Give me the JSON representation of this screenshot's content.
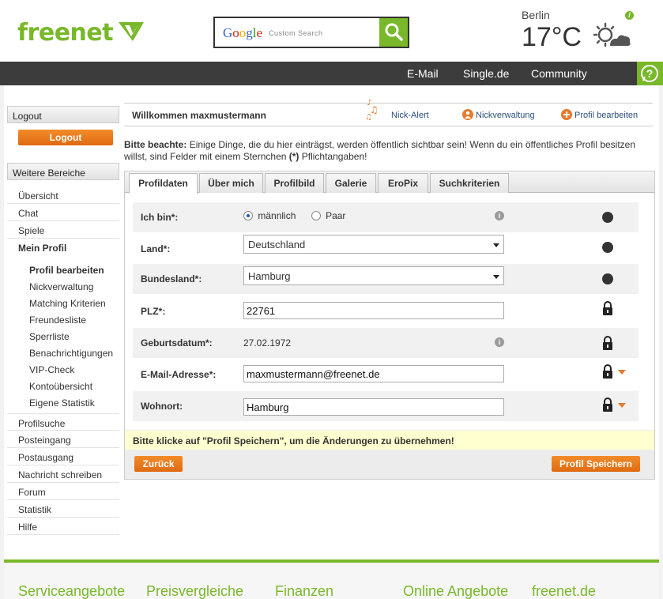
{
  "brand": {
    "logo": "freenet",
    "accent": "#78b82a"
  },
  "search": {
    "brand_letters": [
      "G",
      "o",
      "o",
      "g",
      "l",
      "e"
    ],
    "placeholder": "Custom Search"
  },
  "weather": {
    "city": "Berlin",
    "temp": "17°C",
    "icon": "sun-cloud-icon"
  },
  "topnav": {
    "items": [
      "E-Mail",
      "Single.de",
      "Community"
    ]
  },
  "sidebar": {
    "logout_header": "Logout",
    "logout_button": "Logout",
    "areas_header": "Weitere Bereiche",
    "links_top": [
      "Übersicht",
      "Chat",
      "Spiele"
    ],
    "my_profile": "Mein Profil",
    "sub_links": [
      "Profil bearbeiten",
      "Nickverwaltung",
      "Matching Kriterien",
      "Freundesliste",
      "Sperrliste",
      "Benachrichtigungen",
      "VIP-Check",
      "Kontoübersicht",
      "Eigene Statistik"
    ],
    "links_bottom": [
      "Profilsuche",
      "Posteingang",
      "Postausgang",
      "Nachricht schreiben",
      "Forum",
      "Statistik",
      "Hilfe"
    ]
  },
  "welcome": {
    "text": "Willkommen maxmustermann",
    "actions": [
      "Nick-Alert",
      "Nickverwaltung",
      "Profil bearbeiten"
    ]
  },
  "notice": {
    "bold": "Bitte beachte:",
    "text": " Einige Dinge, die du hier einträgst, werden öffentlich sichtbar sein! Wenn du ein öffentliches Profil besitzen willst, sind Felder mit einem Sternchen ",
    "star": "(*)",
    "tail": " Pflichtangaben!"
  },
  "tabs": [
    "Profildaten",
    "Über mich",
    "Profilbild",
    "Galerie",
    "EroPix",
    "Suchkriterien"
  ],
  "form": {
    "gender_label": "Ich bin*:",
    "gender_options": [
      "männlich",
      "Paar"
    ],
    "country_label": "Land*:",
    "country_value": "Deutschland",
    "state_label": "Bundesland*:",
    "state_value": "Hamburg",
    "zip_label": "PLZ*:",
    "zip_value": "22761",
    "birth_label": "Geburtsdatum*:",
    "birth_value": "27.02.1972",
    "email_label": "E-Mail-Adresse*:",
    "email_value": "maxmustermann@freenet.de",
    "city_label": "Wohnort:",
    "city_value": "Hamburg"
  },
  "save_hint": "Bitte klicke auf \"Profil Speichern\", um die Änderungen zu übernehmen!",
  "buttons": {
    "back": "Zurück",
    "save": "Profil Speichern"
  },
  "footer": [
    "Serviceangebote",
    "Preisvergleiche",
    "Finanzen",
    "Online Angebote",
    "freenet.de"
  ]
}
